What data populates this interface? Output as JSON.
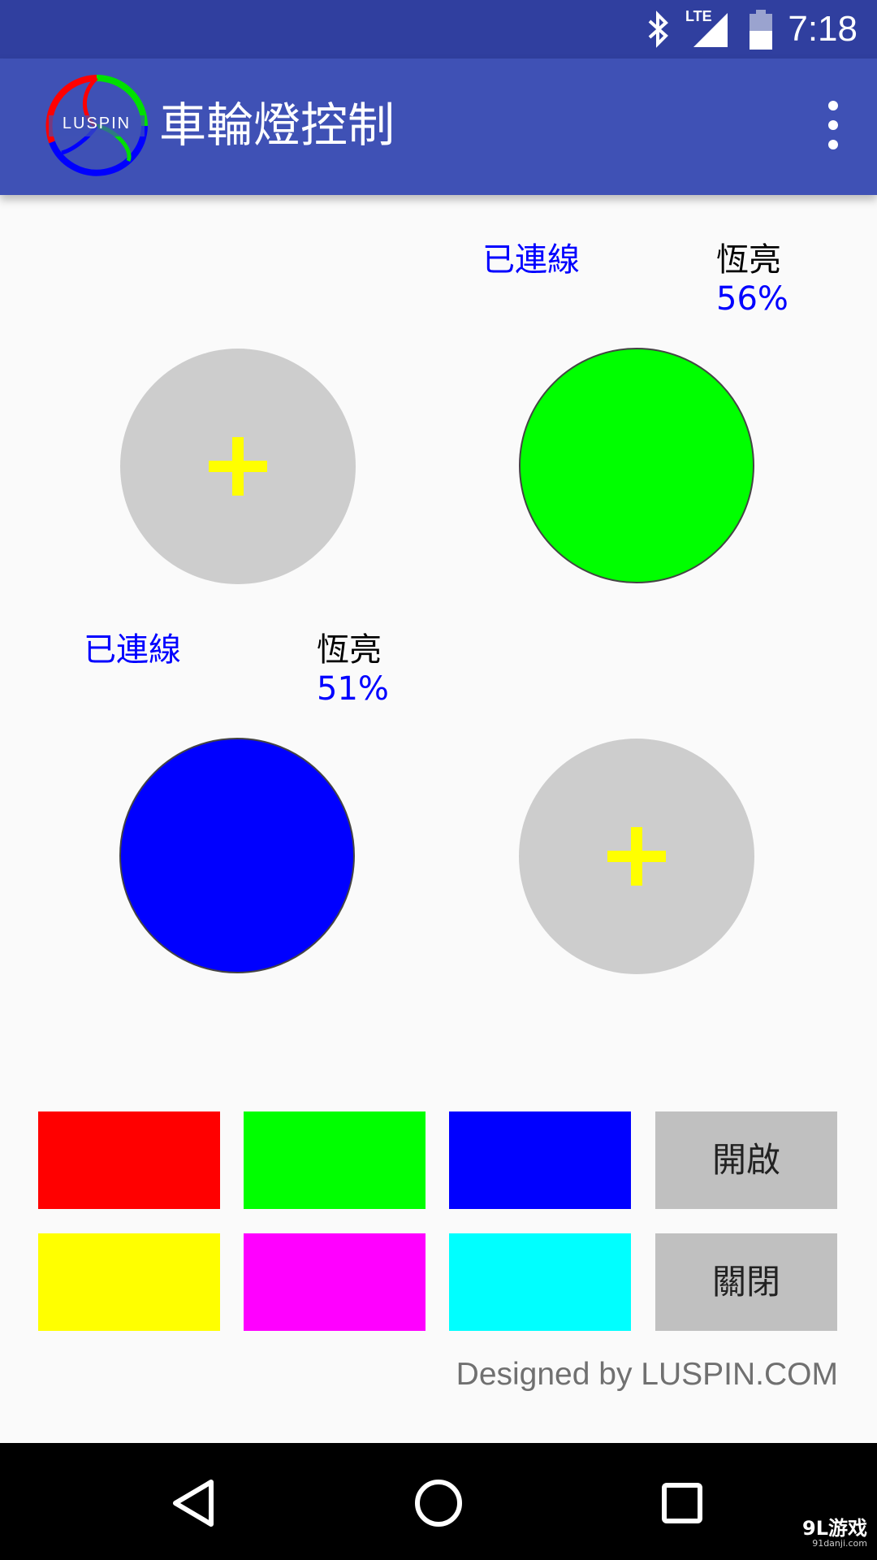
{
  "status_bar": {
    "time": "7:18",
    "icons": [
      "bluetooth-icon",
      "lte-signal-icon",
      "battery-icon"
    ],
    "network_label": "LTE"
  },
  "app_bar": {
    "logo_text": "LUSPIN",
    "title": "車輪燈控制",
    "menu_icon": "overflow-menu-icon"
  },
  "devices": [
    {
      "slot": 1,
      "state": "empty",
      "icon": "add-icon"
    },
    {
      "slot": 2,
      "state": "connected",
      "status": "已連線",
      "mode": "恆亮",
      "brightness": "56%",
      "color": "#00ff00"
    },
    {
      "slot": 3,
      "state": "connected",
      "status": "已連線",
      "mode": "恆亮",
      "brightness": "51%",
      "color": "#0000ff"
    },
    {
      "slot": 4,
      "state": "empty",
      "icon": "add-icon"
    }
  ],
  "color_swatches": [
    {
      "name": "red",
      "color": "#ff0000"
    },
    {
      "name": "green",
      "color": "#00ff00"
    },
    {
      "name": "blue",
      "color": "#0000ff"
    },
    {
      "name": "yellow",
      "color": "#ffff00"
    },
    {
      "name": "magenta",
      "color": "#ff00ff"
    },
    {
      "name": "cyan",
      "color": "#00ffff"
    }
  ],
  "buttons": {
    "on_label": "開啟",
    "off_label": "關閉"
  },
  "footer": {
    "credit": "Designed by LUSPIN.COM"
  },
  "nav_bar": {
    "icons": [
      "back-icon",
      "home-icon",
      "recents-icon"
    ]
  },
  "watermark": {
    "text": "9L游戏",
    "url": "91danji.com"
  }
}
